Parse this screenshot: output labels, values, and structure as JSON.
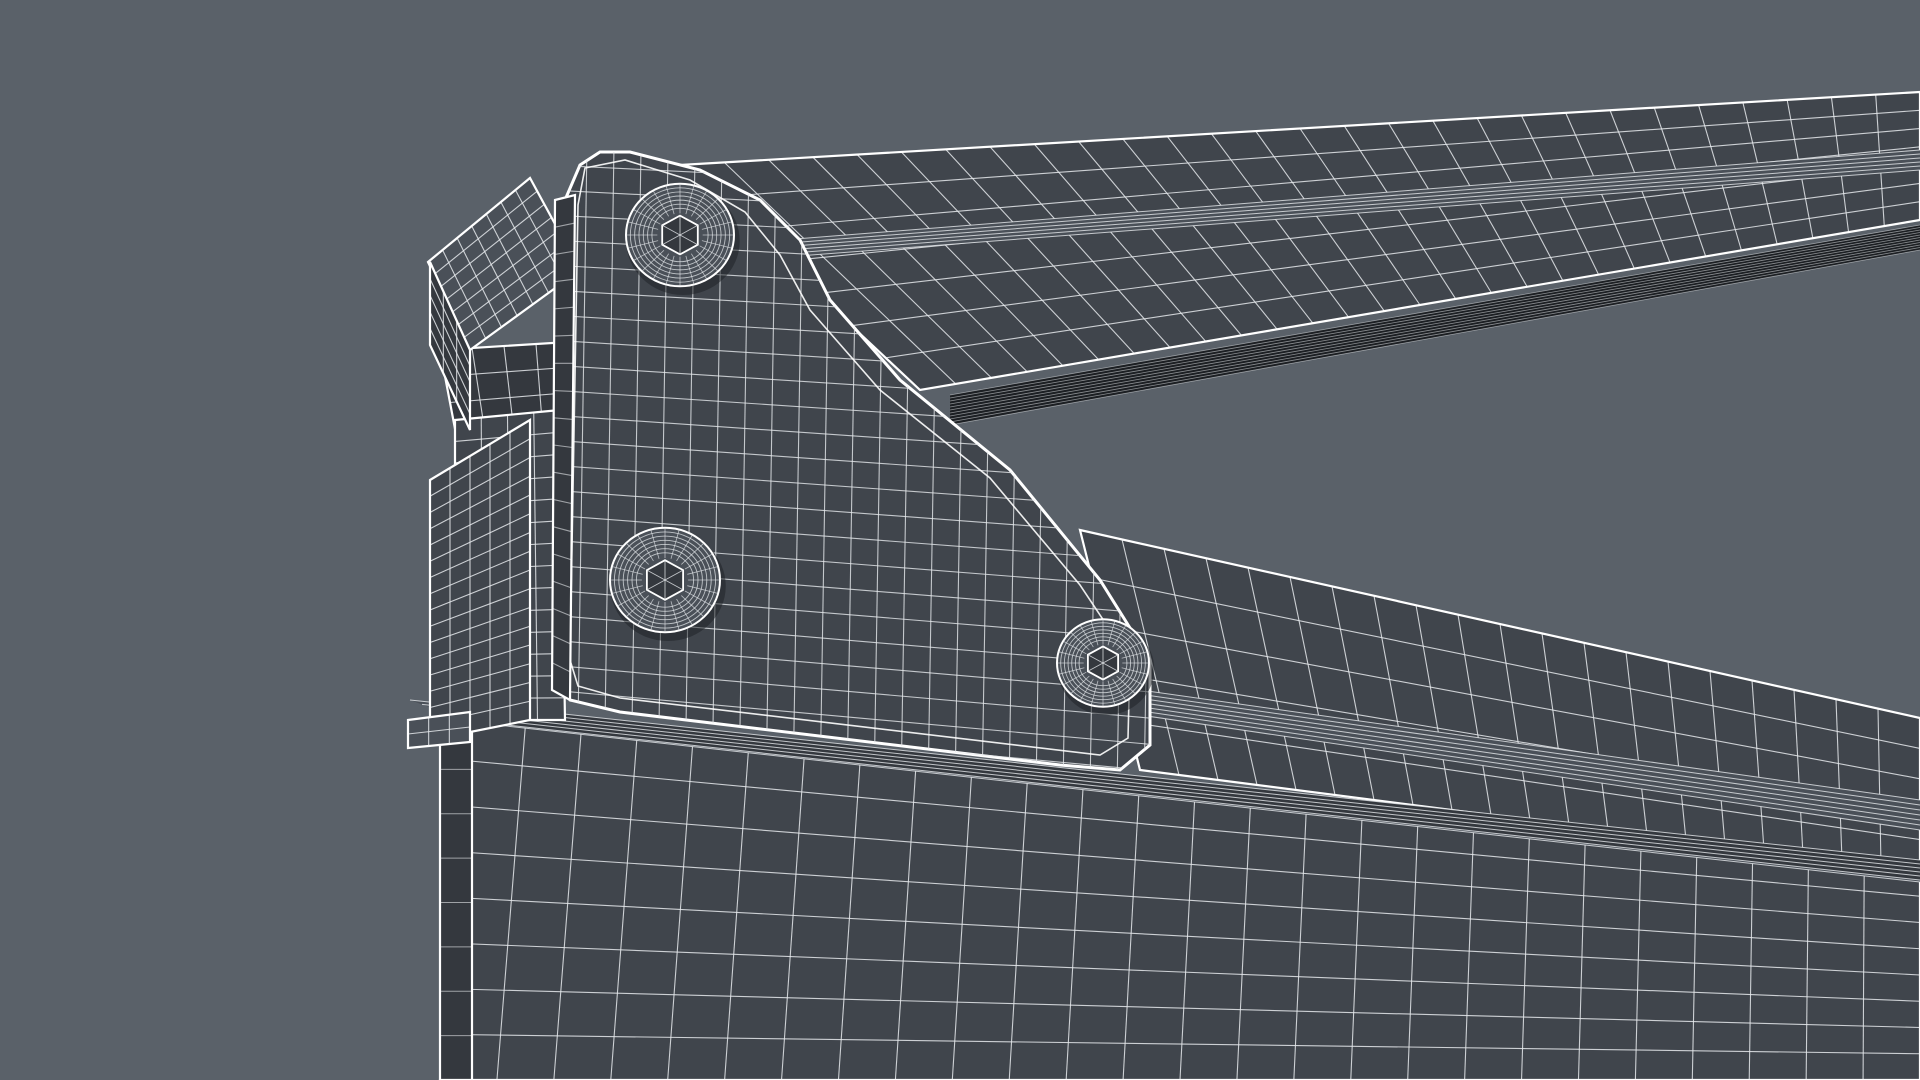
{
  "scene": {
    "background_color": "#5a6169",
    "surface_color": "#40454c",
    "surface_dark_color": "#34383e",
    "surface_light_color": "#4a5058",
    "wire_color": "#e6e9ec",
    "edge_color": "#ffffff",
    "shadow_color": "#1c1f23"
  },
  "objects": [
    {
      "name": "upper-handle",
      "kind": "wireframe mesh"
    },
    {
      "name": "lower-arm",
      "kind": "wireframe mesh"
    },
    {
      "name": "base-plate",
      "kind": "wireframe mesh"
    },
    {
      "name": "side-bracket",
      "kind": "wireframe mesh"
    },
    {
      "name": "pivot-block",
      "kind": "wireframe mesh"
    },
    {
      "name": "clamp-block",
      "kind": "wireframe mesh"
    }
  ],
  "screws": [
    {
      "name": "screw-top",
      "head": "hex-socket"
    },
    {
      "name": "screw-middle",
      "head": "hex-socket"
    },
    {
      "name": "screw-bottom-right",
      "head": "hex-socket"
    }
  ]
}
